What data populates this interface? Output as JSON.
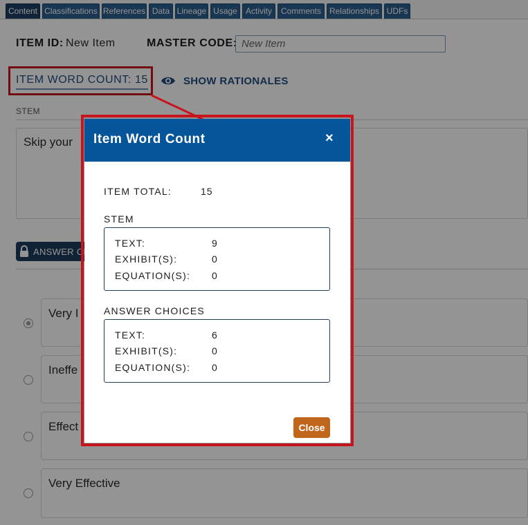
{
  "tabs": [
    "Content",
    "Classifications",
    "References",
    "Data",
    "Lineage",
    "Usage",
    "Activity",
    "Comments",
    "Relationships",
    "UDFs"
  ],
  "item_id": {
    "label": "ITEM ID:",
    "value": "New Item"
  },
  "master_code": {
    "label": "MASTER CODE:",
    "placeholder": "New Item"
  },
  "word_count_link": "ITEM WORD COUNT: 15",
  "show_rationales": "SHOW RATIONALES",
  "stem": {
    "label": "STEM",
    "text": "Skip your"
  },
  "answer_choices_button": "ANSWER CH",
  "choices": [
    "Very I",
    "Ineffe",
    "Effect",
    "Very Effective"
  ],
  "modal": {
    "title": "Item Word Count",
    "close_x": "×",
    "item_total_label": "ITEM TOTAL:",
    "item_total_value": "15",
    "stem_heading": "STEM",
    "stem_rows": [
      {
        "label": "TEXT:",
        "value": "9"
      },
      {
        "label": "EXHIBIT(S):",
        "value": "0"
      },
      {
        "label": "EQUATION(S):",
        "value": "0"
      }
    ],
    "answers_heading": "ANSWER CHOICES",
    "answer_rows": [
      {
        "label": "TEXT:",
        "value": "6"
      },
      {
        "label": "EXHIBIT(S):",
        "value": "0"
      },
      {
        "label": "EQUATION(S):",
        "value": "0"
      }
    ],
    "close_button": "Close"
  },
  "colors": {
    "modal_header": "#05559a",
    "callout_red": "#c8141c",
    "close_button": "#c0661c",
    "tab_blue": "#2b5d8e"
  }
}
